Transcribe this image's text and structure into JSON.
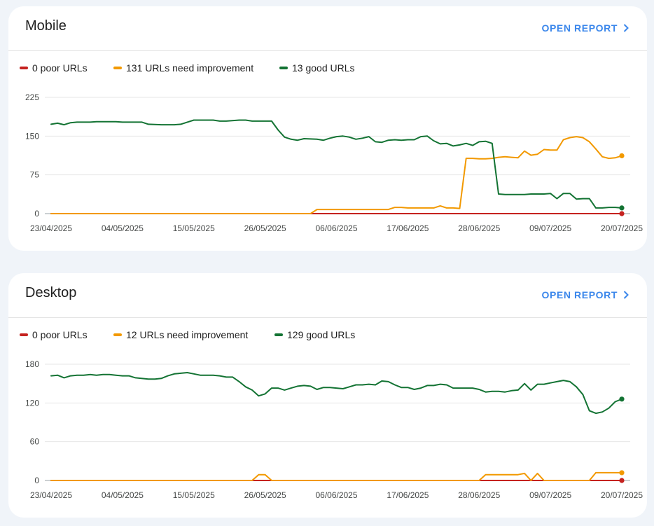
{
  "colors": {
    "poor": "#c5221f",
    "needs_improvement": "#f29900",
    "good": "#137333"
  },
  "reports": [
    {
      "title": "Mobile",
      "open_report_label": "OPEN REPORT",
      "legend": [
        "0 poor URLs",
        "131 URLs need improvement",
        "13 good URLs"
      ]
    },
    {
      "title": "Desktop",
      "open_report_label": "OPEN REPORT",
      "legend": [
        "0 poor URLs",
        "12 URLs need improvement",
        "129 good URLs"
      ]
    }
  ],
  "chart_data": [
    {
      "type": "line",
      "title": "Mobile",
      "x_ticks": [
        "23/04/2025",
        "04/05/2025",
        "15/05/2025",
        "26/05/2025",
        "06/06/2025",
        "17/06/2025",
        "28/06/2025",
        "09/07/2025",
        "20/07/2025"
      ],
      "x_range": [
        "2025-04-23",
        "2025-07-20"
      ],
      "ylim": [
        0,
        225
      ],
      "y_ticks": [
        0,
        75,
        150,
        225
      ],
      "grid": true,
      "legend_position": "top-left",
      "series": [
        {
          "name": "0 poor URLs",
          "color": "#c5221f",
          "points": [
            [
              "2025-04-23",
              0
            ],
            [
              "2025-07-20",
              0
            ]
          ]
        },
        {
          "name": "131 URLs need improvement",
          "color": "#f29900",
          "points": [
            [
              "2025-04-23",
              0
            ],
            [
              "2025-06-02",
              0
            ],
            [
              "2025-06-03",
              8
            ],
            [
              "2025-06-14",
              8
            ],
            [
              "2025-06-15",
              12
            ],
            [
              "2025-06-16",
              12
            ],
            [
              "2025-06-17",
              11
            ],
            [
              "2025-06-20",
              11
            ],
            [
              "2025-06-21",
              11
            ],
            [
              "2025-06-22",
              15
            ],
            [
              "2025-06-23",
              11
            ],
            [
              "2025-06-24",
              11
            ],
            [
              "2025-06-25",
              10
            ],
            [
              "2025-06-26",
              107
            ],
            [
              "2025-06-27",
              107
            ],
            [
              "2025-06-28",
              106
            ],
            [
              "2025-06-29",
              106
            ],
            [
              "2025-06-30",
              107
            ],
            [
              "2025-07-01",
              109
            ],
            [
              "2025-07-02",
              110
            ],
            [
              "2025-07-03",
              109
            ],
            [
              "2025-07-04",
              108
            ],
            [
              "2025-07-05",
              121
            ],
            [
              "2025-07-06",
              113
            ],
            [
              "2025-07-07",
              115
            ],
            [
              "2025-07-08",
              124
            ],
            [
              "2025-07-09",
              123
            ],
            [
              "2025-07-10",
              123
            ],
            [
              "2025-07-11",
              143
            ],
            [
              "2025-07-12",
              147
            ],
            [
              "2025-07-13",
              149
            ],
            [
              "2025-07-14",
              147
            ],
            [
              "2025-07-15",
              139
            ],
            [
              "2025-07-16",
              125
            ],
            [
              "2025-07-17",
              110
            ],
            [
              "2025-07-18",
              107
            ],
            [
              "2025-07-19",
              108
            ],
            [
              "2025-07-20",
              112
            ],
            [
              "2025-07-21",
              120
            ],
            [
              "2025-07-22",
              126
            ],
            [
              "2025-07-23",
              131
            ]
          ]
        },
        {
          "name": "13 good URLs",
          "color": "#137333",
          "points": [
            [
              "2025-04-23",
              173
            ],
            [
              "2025-04-24",
              175
            ],
            [
              "2025-04-25",
              172
            ],
            [
              "2025-04-26",
              176
            ],
            [
              "2025-04-27",
              177
            ],
            [
              "2025-04-29",
              177
            ],
            [
              "2025-04-30",
              178
            ],
            [
              "2025-05-03",
              178
            ],
            [
              "2025-05-04",
              177
            ],
            [
              "2025-05-07",
              177
            ],
            [
              "2025-05-08",
              173
            ],
            [
              "2025-05-10",
              172
            ],
            [
              "2025-05-12",
              172
            ],
            [
              "2025-05-13",
              173
            ],
            [
              "2025-05-14",
              177
            ],
            [
              "2025-05-15",
              181
            ],
            [
              "2025-05-18",
              181
            ],
            [
              "2025-05-19",
              179
            ],
            [
              "2025-05-20",
              179
            ],
            [
              "2025-05-22",
              181
            ],
            [
              "2025-05-23",
              181
            ],
            [
              "2025-05-24",
              179
            ],
            [
              "2025-05-27",
              179
            ],
            [
              "2025-05-28",
              162
            ],
            [
              "2025-05-29",
              148
            ],
            [
              "2025-05-30",
              144
            ],
            [
              "2025-05-31",
              142
            ],
            [
              "2025-06-01",
              145
            ],
            [
              "2025-06-03",
              144
            ],
            [
              "2025-06-04",
              142
            ],
            [
              "2025-06-05",
              146
            ],
            [
              "2025-06-06",
              149
            ],
            [
              "2025-06-07",
              150
            ],
            [
              "2025-06-08",
              148
            ],
            [
              "2025-06-09",
              144
            ],
            [
              "2025-06-10",
              146
            ],
            [
              "2025-06-11",
              149
            ],
            [
              "2025-06-12",
              139
            ],
            [
              "2025-06-13",
              138
            ],
            [
              "2025-06-14",
              142
            ],
            [
              "2025-06-15",
              143
            ],
            [
              "2025-06-16",
              142
            ],
            [
              "2025-06-17",
              143
            ],
            [
              "2025-06-18",
              143
            ],
            [
              "2025-06-19",
              149
            ],
            [
              "2025-06-20",
              150
            ],
            [
              "2025-06-21",
              141
            ],
            [
              "2025-06-22",
              135
            ],
            [
              "2025-06-23",
              136
            ],
            [
              "2025-06-24",
              131
            ],
            [
              "2025-06-25",
              133
            ],
            [
              "2025-06-26",
              136
            ],
            [
              "2025-06-27",
              132
            ],
            [
              "2025-06-28",
              139
            ],
            [
              "2025-06-29",
              140
            ],
            [
              "2025-06-30",
              136
            ],
            [
              "2025-07-01",
              38
            ],
            [
              "2025-07-02",
              37
            ],
            [
              "2025-07-05",
              37
            ],
            [
              "2025-07-06",
              38
            ],
            [
              "2025-07-08",
              38
            ],
            [
              "2025-07-09",
              39
            ],
            [
              "2025-07-10",
              29
            ],
            [
              "2025-07-11",
              39
            ],
            [
              "2025-07-12",
              39
            ],
            [
              "2025-07-13",
              28
            ],
            [
              "2025-07-14",
              29
            ],
            [
              "2025-07-15",
              29
            ],
            [
              "2025-07-16",
              11
            ],
            [
              "2025-07-17",
              11
            ],
            [
              "2025-07-18",
              12
            ],
            [
              "2025-07-19",
              12
            ],
            [
              "2025-07-20",
              11
            ],
            [
              "2025-07-21",
              10
            ],
            [
              "2025-07-24",
              10
            ],
            [
              "2025-07-25",
              11
            ],
            [
              "2025-07-27",
              12
            ],
            [
              "2025-07-28",
              13
            ]
          ]
        }
      ]
    },
    {
      "type": "line",
      "title": "Desktop",
      "x_ticks": [
        "23/04/2025",
        "04/05/2025",
        "15/05/2025",
        "26/05/2025",
        "06/06/2025",
        "17/06/2025",
        "28/06/2025",
        "09/07/2025",
        "20/07/2025"
      ],
      "x_range": [
        "2025-04-23",
        "2025-07-20"
      ],
      "ylim": [
        0,
        180
      ],
      "y_ticks": [
        0,
        60,
        120,
        180
      ],
      "grid": true,
      "legend_position": "top-left",
      "series": [
        {
          "name": "0 poor URLs",
          "color": "#c5221f",
          "points": [
            [
              "2025-04-23",
              0
            ],
            [
              "2025-07-20",
              0
            ]
          ]
        },
        {
          "name": "12 URLs need improvement",
          "color": "#f29900",
          "points": [
            [
              "2025-04-23",
              0
            ],
            [
              "2025-05-24",
              0
            ],
            [
              "2025-05-25",
              9
            ],
            [
              "2025-05-26",
              9
            ],
            [
              "2025-05-27",
              0
            ],
            [
              "2025-06-28",
              0
            ],
            [
              "2025-06-29",
              9
            ],
            [
              "2025-07-04",
              9
            ],
            [
              "2025-07-05",
              11
            ],
            [
              "2025-07-06",
              0
            ],
            [
              "2025-07-07",
              11
            ],
            [
              "2025-07-08",
              0
            ],
            [
              "2025-07-15",
              0
            ],
            [
              "2025-07-16",
              12
            ],
            [
              "2025-07-20",
              12
            ]
          ]
        },
        {
          "name": "129 good URLs",
          "color": "#137333",
          "points": [
            [
              "2025-04-23",
              162
            ],
            [
              "2025-04-24",
              163
            ],
            [
              "2025-04-25",
              159
            ],
            [
              "2025-04-26",
              162
            ],
            [
              "2025-04-27",
              163
            ],
            [
              "2025-04-28",
              163
            ],
            [
              "2025-04-29",
              164
            ],
            [
              "2025-04-30",
              163
            ],
            [
              "2025-05-01",
              164
            ],
            [
              "2025-05-02",
              164
            ],
            [
              "2025-05-03",
              163
            ],
            [
              "2025-05-04",
              162
            ],
            [
              "2025-05-05",
              162
            ],
            [
              "2025-05-06",
              159
            ],
            [
              "2025-05-08",
              157
            ],
            [
              "2025-05-09",
              157
            ],
            [
              "2025-05-10",
              158
            ],
            [
              "2025-05-11",
              162
            ],
            [
              "2025-05-12",
              165
            ],
            [
              "2025-05-13",
              166
            ],
            [
              "2025-05-14",
              167
            ],
            [
              "2025-05-15",
              165
            ],
            [
              "2025-05-16",
              163
            ],
            [
              "2025-05-18",
              163
            ],
            [
              "2025-05-19",
              162
            ],
            [
              "2025-05-20",
              160
            ],
            [
              "2025-05-21",
              160
            ],
            [
              "2025-05-22",
              153
            ],
            [
              "2025-05-23",
              145
            ],
            [
              "2025-05-24",
              140
            ],
            [
              "2025-05-25",
              131
            ],
            [
              "2025-05-26",
              134
            ],
            [
              "2025-05-27",
              143
            ],
            [
              "2025-05-28",
              143
            ],
            [
              "2025-05-29",
              140
            ],
            [
              "2025-05-30",
              143
            ],
            [
              "2025-05-31",
              146
            ],
            [
              "2025-06-01",
              147
            ],
            [
              "2025-06-02",
              146
            ],
            [
              "2025-06-03",
              141
            ],
            [
              "2025-06-04",
              144
            ],
            [
              "2025-06-05",
              144
            ],
            [
              "2025-06-06",
              143
            ],
            [
              "2025-06-07",
              142
            ],
            [
              "2025-06-08",
              145
            ],
            [
              "2025-06-09",
              148
            ],
            [
              "2025-06-10",
              148
            ],
            [
              "2025-06-11",
              149
            ],
            [
              "2025-06-12",
              148
            ],
            [
              "2025-06-13",
              154
            ],
            [
              "2025-06-14",
              153
            ],
            [
              "2025-06-15",
              148
            ],
            [
              "2025-06-16",
              144
            ],
            [
              "2025-06-17",
              144
            ],
            [
              "2025-06-18",
              141
            ],
            [
              "2025-06-19",
              143
            ],
            [
              "2025-06-20",
              147
            ],
            [
              "2025-06-21",
              147
            ],
            [
              "2025-06-22",
              149
            ],
            [
              "2025-06-23",
              148
            ],
            [
              "2025-06-24",
              143
            ],
            [
              "2025-06-27",
              143
            ],
            [
              "2025-06-28",
              141
            ],
            [
              "2025-06-29",
              137
            ],
            [
              "2025-06-30",
              138
            ],
            [
              "2025-07-01",
              138
            ],
            [
              "2025-07-02",
              137
            ],
            [
              "2025-07-03",
              139
            ],
            [
              "2025-07-04",
              140
            ],
            [
              "2025-07-05",
              150
            ],
            [
              "2025-07-06",
              140
            ],
            [
              "2025-07-07",
              149
            ],
            [
              "2025-07-08",
              149
            ],
            [
              "2025-07-09",
              151
            ],
            [
              "2025-07-10",
              153
            ],
            [
              "2025-07-11",
              155
            ],
            [
              "2025-07-12",
              153
            ],
            [
              "2025-07-13",
              145
            ],
            [
              "2025-07-14",
              133
            ],
            [
              "2025-07-15",
              108
            ],
            [
              "2025-07-16",
              104
            ],
            [
              "2025-07-17",
              106
            ],
            [
              "2025-07-18",
              112
            ],
            [
              "2025-07-19",
              122
            ],
            [
              "2025-07-20",
              126
            ],
            [
              "2025-07-21",
              129
            ]
          ]
        }
      ]
    }
  ]
}
